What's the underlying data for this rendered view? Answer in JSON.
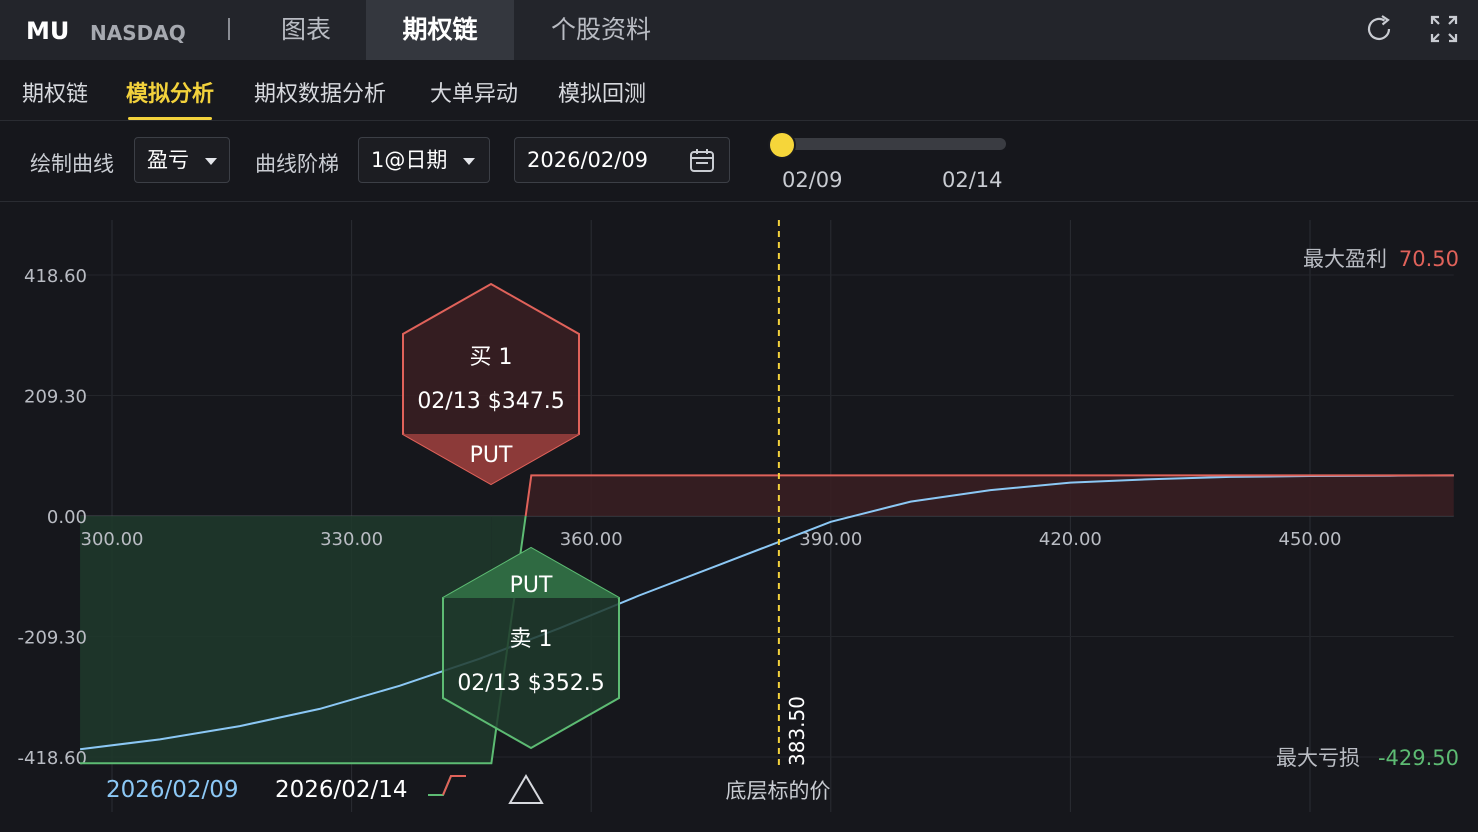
{
  "header": {
    "ticker": "MU",
    "exchange": "NASDAQ",
    "tabs": [
      {
        "label": "图表",
        "active": false
      },
      {
        "label": "期权链",
        "active": true
      },
      {
        "label": "个股资料",
        "active": false
      }
    ],
    "icons": [
      "refresh-icon",
      "fullscreen-icon"
    ]
  },
  "subnav": {
    "tabs": [
      {
        "label": "期权链",
        "active": false
      },
      {
        "label": "模拟分析",
        "active": true
      },
      {
        "label": "期权数据分析",
        "active": false
      },
      {
        "label": "大单异动",
        "active": false
      },
      {
        "label": "模拟回测",
        "active": false
      }
    ]
  },
  "controls": {
    "curve_label": "绘制曲线",
    "curve_value": "盈亏",
    "step_label": "曲线阶梯",
    "step_value": "1@日期",
    "date_value": "2026/02/09",
    "slider": {
      "start": "02/09",
      "end": "02/14",
      "value": 0
    }
  },
  "colors": {
    "accent": "#f3d23c",
    "profit": "#e0625a",
    "loss": "#5dbb73",
    "curve_today": "#8cc8f5",
    "background": "#16171c"
  },
  "chart_data": {
    "type": "line",
    "xlim": [
      296,
      468
    ],
    "ylim": [
      -470,
      500
    ],
    "x_ticks": [
      300,
      330,
      360,
      390,
      420,
      450
    ],
    "x_tick_labels": [
      "300.00",
      "330.00",
      "360.00",
      "390.00",
      "420.00",
      "450.00"
    ],
    "y_ticks": [
      418.6,
      209.3,
      0,
      -209.3,
      -418.6
    ],
    "y_tick_labels": [
      "418.60",
      "209.30",
      "0.00",
      "-209.30",
      "-418.60"
    ],
    "grid": true,
    "underlying_price": 383.5,
    "underlying_price_label": "383.50",
    "underlying_label": "底层标的价",
    "max_profit_label": "最大盈利",
    "max_profit_value": "70.50",
    "max_loss_label": "最大亏损",
    "max_loss_value": "-429.50",
    "series": [
      {
        "name": "2026/02/09",
        "x": [
          296,
          306,
          316,
          326,
          336,
          346,
          356,
          366,
          376,
          383.5,
          390,
          400,
          410,
          420,
          430,
          440,
          450,
          460,
          468
        ],
        "y": [
          -405,
          -388,
          -365,
          -335,
          -295,
          -248,
          -195,
          -138,
          -85,
          -45,
          -10,
          25,
          45,
          58,
          64,
          68,
          69.5,
          70,
          70.5
        ]
      },
      {
        "name": "2026/02/14",
        "x": [
          296,
          347.5,
          352.5,
          468
        ],
        "y": [
          -429.5,
          -429.5,
          70.5,
          70.5
        ]
      }
    ]
  },
  "legs": [
    {
      "action": "买 1",
      "detail": "02/13 $347.5",
      "type": "PUT",
      "tone": "profit"
    },
    {
      "action": "卖 1",
      "detail": "02/13 $352.5",
      "type": "PUT",
      "tone": "loss"
    }
  ],
  "legend": {
    "date1": "2026/02/09",
    "date2": "2026/02/14"
  }
}
